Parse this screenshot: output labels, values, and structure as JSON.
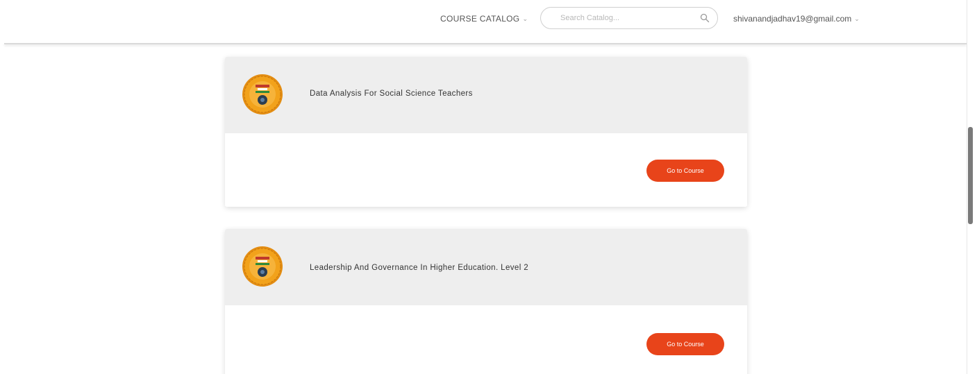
{
  "header": {
    "catalog_label": "COURSE CATALOG",
    "search_placeholder": "Search Catalog...",
    "search_value": "",
    "user_email": "shivanandjadhav19@gmail.com",
    "caret": "⌄"
  },
  "courses": [
    {
      "title": "Data Analysis For Social Science Teachers",
      "button_label": "Go to Course"
    },
    {
      "title": "Leadership And Governance In Higher Education. Level 2",
      "button_label": "Go to Course"
    }
  ],
  "colors": {
    "accent": "#e8441a",
    "card_header_bg": "#eeeeee",
    "logo_gold": "#f2a21b"
  },
  "icons": {
    "search": "search-icon",
    "logo": "university-emblem-icon",
    "caret": "chevron-down-icon"
  }
}
